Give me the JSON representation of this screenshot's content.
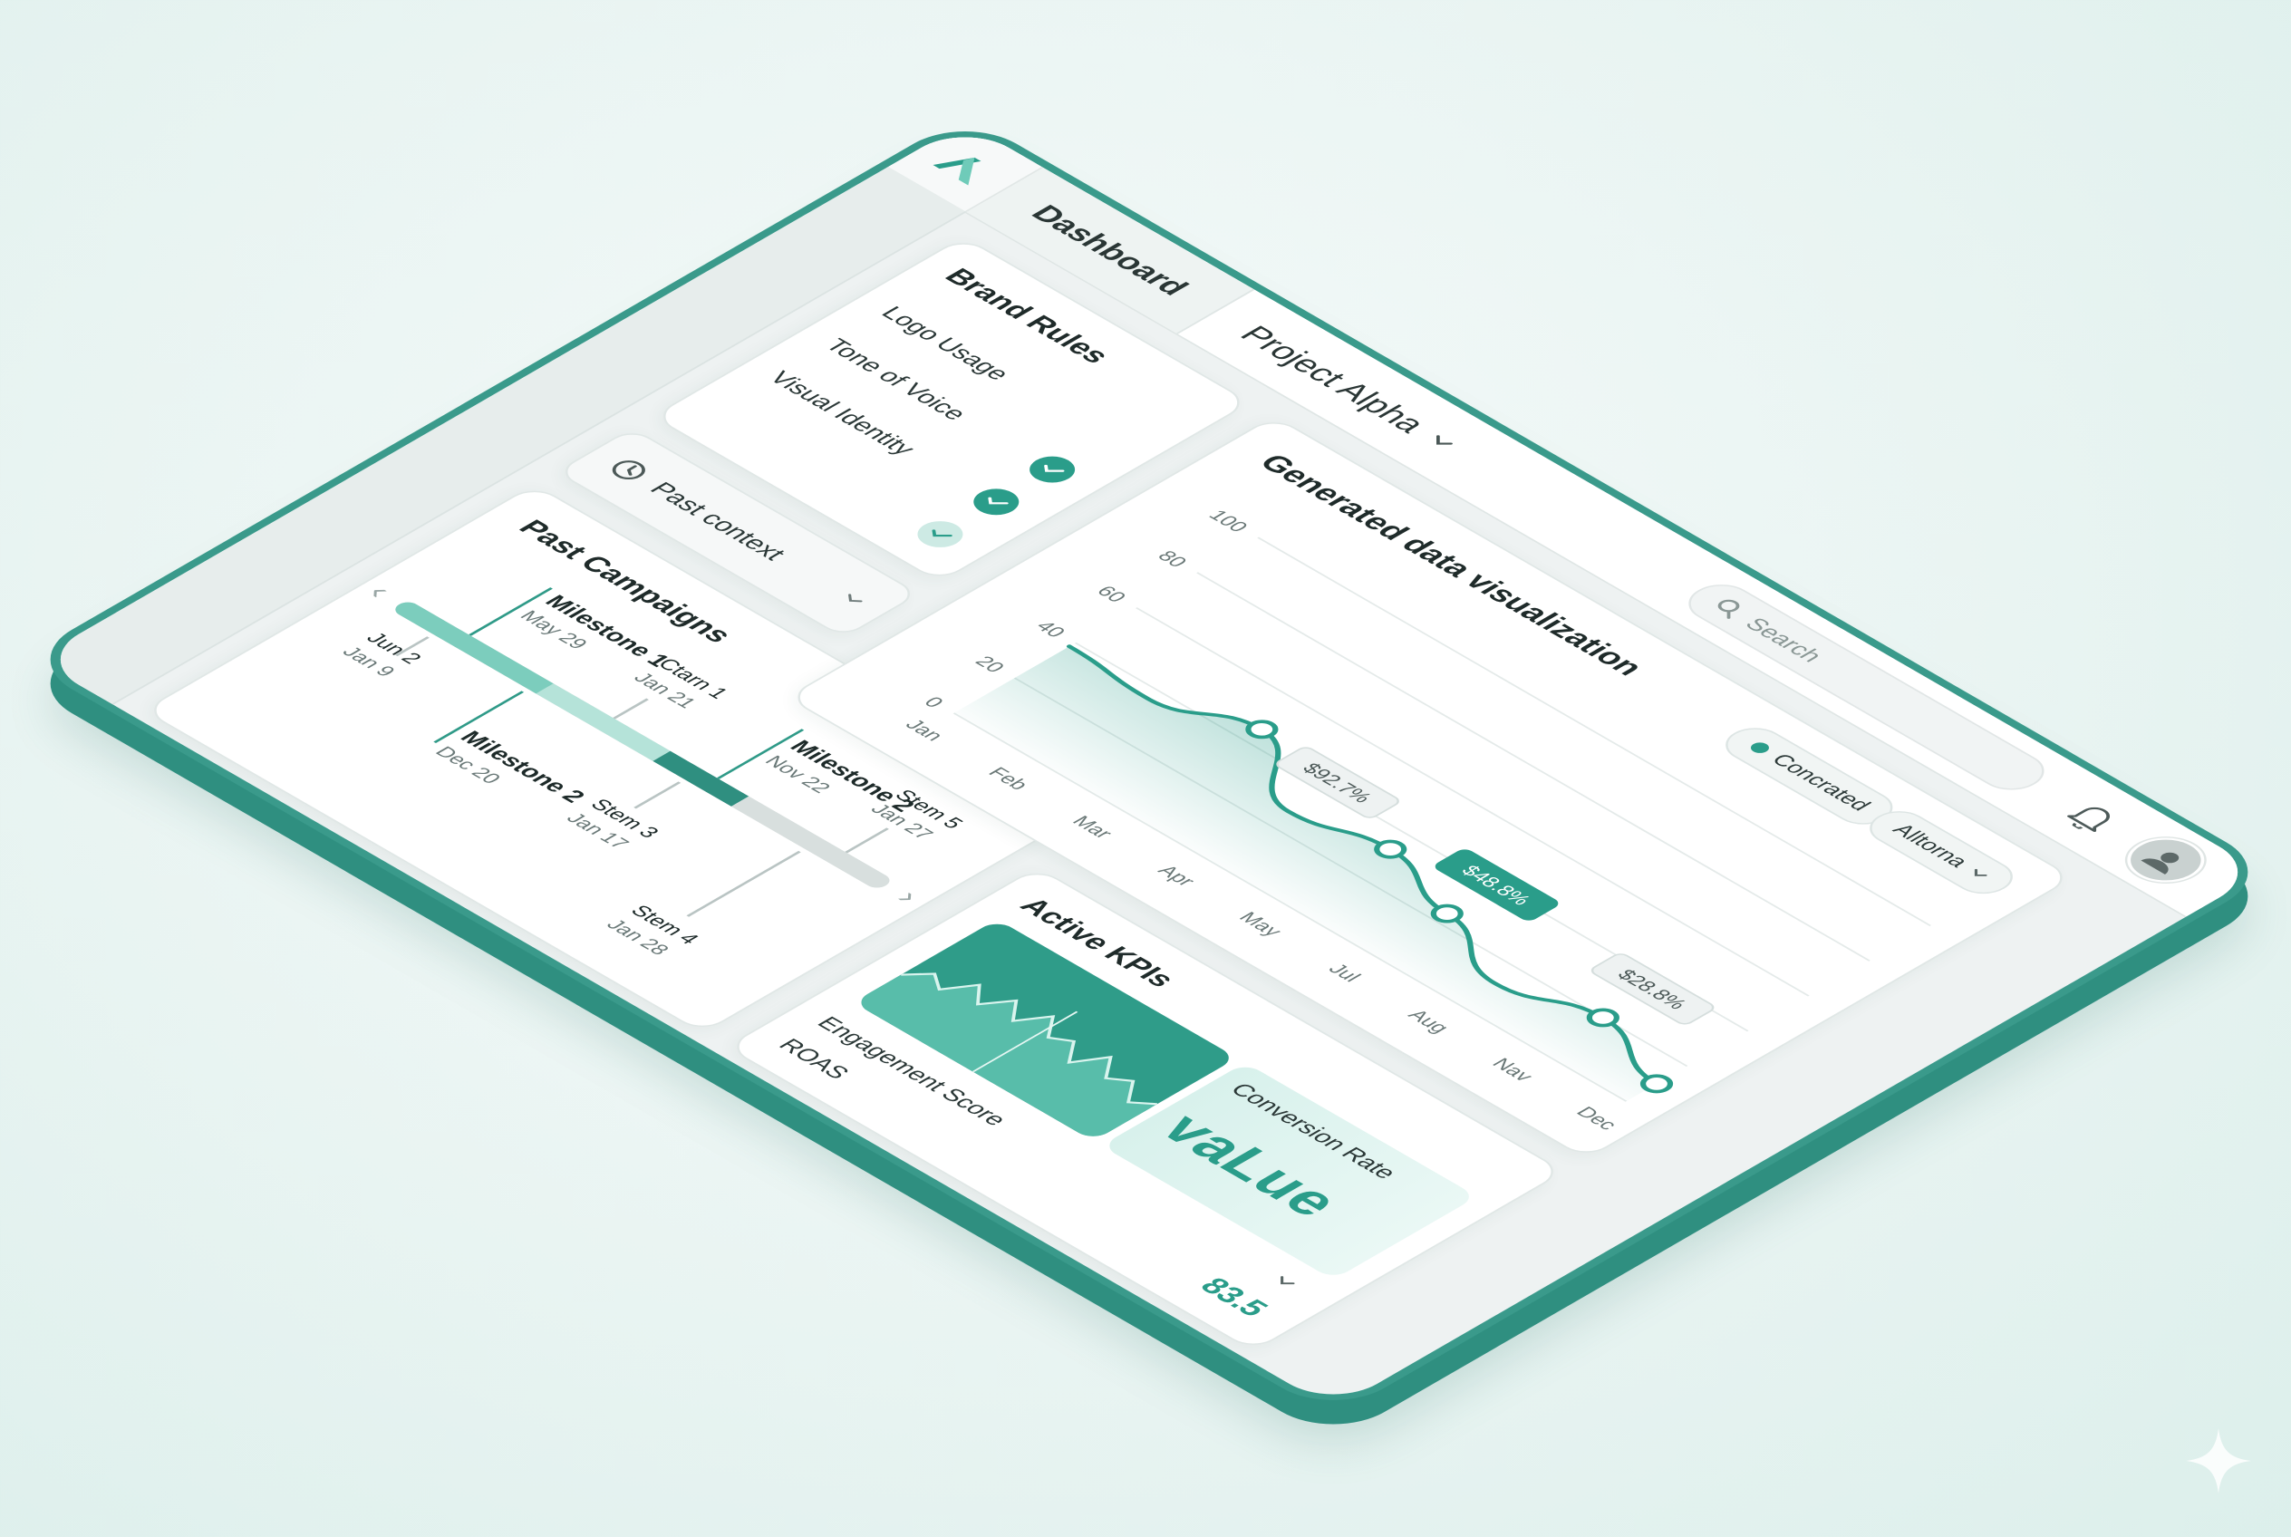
{
  "app": {
    "tab_label": "Dashboard",
    "project_label": "Project Alpha",
    "search_placeholder": "Search"
  },
  "brand_rules": {
    "title": "Brand Rules",
    "items": [
      {
        "label": "Logo Usage",
        "state": "none"
      },
      {
        "label": "Tone of Voice",
        "state": "checked"
      },
      {
        "label": "Visual Identity",
        "state": "checked"
      },
      {
        "label": "",
        "state": "partial"
      }
    ]
  },
  "past_context": {
    "label": "Past context"
  },
  "past_campaigns": {
    "title": "Past Campaigns",
    "milestones": [
      {
        "name": "Milestone 1",
        "date": "May 29"
      },
      {
        "name": "Milestone 2",
        "date": "Dec 20"
      },
      {
        "name": "Milestone 2",
        "date": "Nov 22"
      }
    ],
    "steps": [
      {
        "name": "Jun 2",
        "date": "Jan 9"
      },
      {
        "name": "Ctarn 1",
        "date": "Jan 21"
      },
      {
        "name": "Stem 3",
        "date": "Jan 17"
      },
      {
        "name": "Stem 4",
        "date": "Jan 28"
      },
      {
        "name": "Stem 5",
        "date": "Jan 27"
      }
    ]
  },
  "chart": {
    "title": "Generated data visualization",
    "legend_label": "Concrated",
    "filter_label": "Alltorna"
  },
  "chart_data": {
    "type": "line",
    "title": "Generated data visualization",
    "categories": [
      "Jan",
      "Feb",
      "Mar",
      "Apr",
      "May",
      "Jul",
      "Aug",
      "Nav",
      "Dec"
    ],
    "yticks": [
      0,
      20,
      40,
      60,
      80,
      100
    ],
    "ylim": [
      0,
      100
    ],
    "series": [
      {
        "values": [
          38,
          36,
          46,
          27,
          33,
          24,
          12,
          20,
          10
        ]
      }
    ],
    "annotations": [
      {
        "label": "$92.7%",
        "category": "Apr"
      },
      {
        "label": "$48.8%",
        "category": "Jul"
      },
      {
        "label": "$28.8%",
        "category": "Nav"
      }
    ],
    "grid": true,
    "accent": "#2a9d8a"
  },
  "kpis": {
    "title": "Active KPIs",
    "rows": [
      {
        "label": "Engagement Score"
      },
      {
        "label": "ROAS"
      },
      {
        "label": "Conversion Rate"
      }
    ],
    "hero_value": "vaLue",
    "roas_value": "83.5"
  },
  "colors": {
    "accent": "#2a9d8a",
    "frame": "#3a9a8b"
  }
}
